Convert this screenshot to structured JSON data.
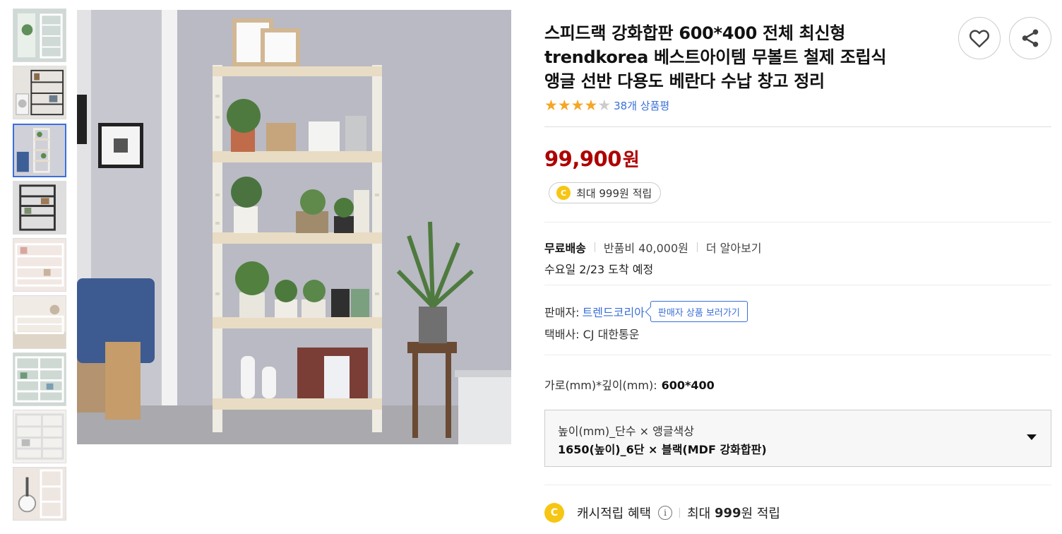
{
  "product": {
    "title_lines": [
      "스피드랙 강화합판 600*400 전체 최신형",
      "trendkorea 베스트아이템 무볼트 철제 조립식",
      "앵글 선반 다용도 베란다 수납 창고 정리"
    ],
    "rating": {
      "stars_filled": 4,
      "stars_total": 5,
      "review_text": "38개 상품평"
    },
    "price": {
      "amount": "99,900",
      "unit": "원"
    },
    "cash_chip": {
      "coin": "C",
      "text": "최대 999원 적립"
    }
  },
  "shipping": {
    "free_label": "무료배송",
    "return_fee": "반품비 40,000원",
    "more_link": "더 알아보기",
    "arrival": "수요일 2/23 도착 예정"
  },
  "seller": {
    "label": "판매자:",
    "name": "트렌드코리아",
    "view_button": "판매자 상품 보러가기",
    "courier": "택배사: CJ 대한통운"
  },
  "dims": {
    "label": "가로(mm)*깊이(mm):",
    "value": "600*400"
  },
  "option": {
    "label": "높이(mm)_단수 × 앵글색상",
    "value": "1650(높이)_6단 × 블랙(MDF 강화합판)"
  },
  "benefit": {
    "coin": "C",
    "label": "캐시적립 혜택",
    "info": "i",
    "prefix": "최대",
    "amount": "999",
    "suffix": "원 적립"
  },
  "icons": {
    "heart": "heart-icon",
    "share": "share-icon",
    "dropdown": "caret-down-icon"
  },
  "colors": {
    "price": "#ae0000",
    "link": "#3a6fd8",
    "star": "#f5a623",
    "coin": "#f7c614",
    "active_thumb": "#3b6fe0"
  }
}
